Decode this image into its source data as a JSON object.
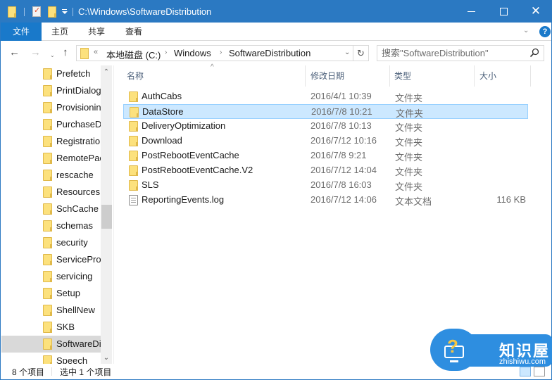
{
  "window": {
    "title": "C:\\Windows\\SoftwareDistribution",
    "accent_color": "#2b79c2"
  },
  "ribbon": {
    "tabs": [
      {
        "label": "文件",
        "active": true
      },
      {
        "label": "主页"
      },
      {
        "label": "共享"
      },
      {
        "label": "查看"
      }
    ],
    "help_label": "?"
  },
  "nav": {
    "back_icon": "←",
    "forward_icon": "→",
    "recent_icon": "⌄",
    "up_icon": "↑"
  },
  "address": {
    "overflow": "«",
    "crumbs": [
      "本地磁盘 (C:)",
      "Windows",
      "SoftwareDistribution"
    ],
    "separator": "›",
    "dropdown_icon": "⌄",
    "refresh_icon": "↻"
  },
  "search": {
    "placeholder": "搜索\"SoftwareDistribution\""
  },
  "nav_pane": {
    "items": [
      {
        "label": "Prefetch"
      },
      {
        "label": "PrintDialog"
      },
      {
        "label": "Provisioning"
      },
      {
        "label": "PurchaseDialog"
      },
      {
        "label": "Registration"
      },
      {
        "label": "RemotePackages"
      },
      {
        "label": "rescache"
      },
      {
        "label": "Resources"
      },
      {
        "label": "SchCache"
      },
      {
        "label": "schemas"
      },
      {
        "label": "security"
      },
      {
        "label": "ServiceProfiles"
      },
      {
        "label": "servicing"
      },
      {
        "label": "Setup"
      },
      {
        "label": "ShellNew"
      },
      {
        "label": "SKB"
      },
      {
        "label": "SoftwareDistribution",
        "selected": true
      },
      {
        "label": "Speech"
      }
    ],
    "scroll_up_icon": "⌃",
    "scroll_down_icon": "⌄"
  },
  "columns": {
    "name": "名称",
    "modified": "修改日期",
    "type": "类型",
    "size": "大小",
    "sort_indicator": "^"
  },
  "files": [
    {
      "name": "AuthCabs",
      "modified": "2016/4/1 10:39",
      "type": "文件夹",
      "size": "",
      "kind": "folder"
    },
    {
      "name": "DataStore",
      "modified": "2016/7/8 10:21",
      "type": "文件夹",
      "size": "",
      "kind": "folder",
      "selected": true
    },
    {
      "name": "DeliveryOptimization",
      "modified": "2016/7/8 10:13",
      "type": "文件夹",
      "size": "",
      "kind": "folder"
    },
    {
      "name": "Download",
      "modified": "2016/7/12 10:16",
      "type": "文件夹",
      "size": "",
      "kind": "folder"
    },
    {
      "name": "PostRebootEventCache",
      "modified": "2016/7/8 9:21",
      "type": "文件夹",
      "size": "",
      "kind": "folder"
    },
    {
      "name": "PostRebootEventCache.V2",
      "modified": "2016/7/12 14:04",
      "type": "文件夹",
      "size": "",
      "kind": "folder"
    },
    {
      "name": "SLS",
      "modified": "2016/7/8 16:03",
      "type": "文件夹",
      "size": "",
      "kind": "folder"
    },
    {
      "name": "ReportingEvents.log",
      "modified": "2016/7/12 14:06",
      "type": "文本文档",
      "size": "116 KB",
      "kind": "document"
    }
  ],
  "status": {
    "item_count": "8 个项目",
    "selected_count": "选中 1 个项目"
  },
  "watermark": {
    "title": "知识屋",
    "url": "zhishiwu.com",
    "icon_glyph": "?"
  }
}
